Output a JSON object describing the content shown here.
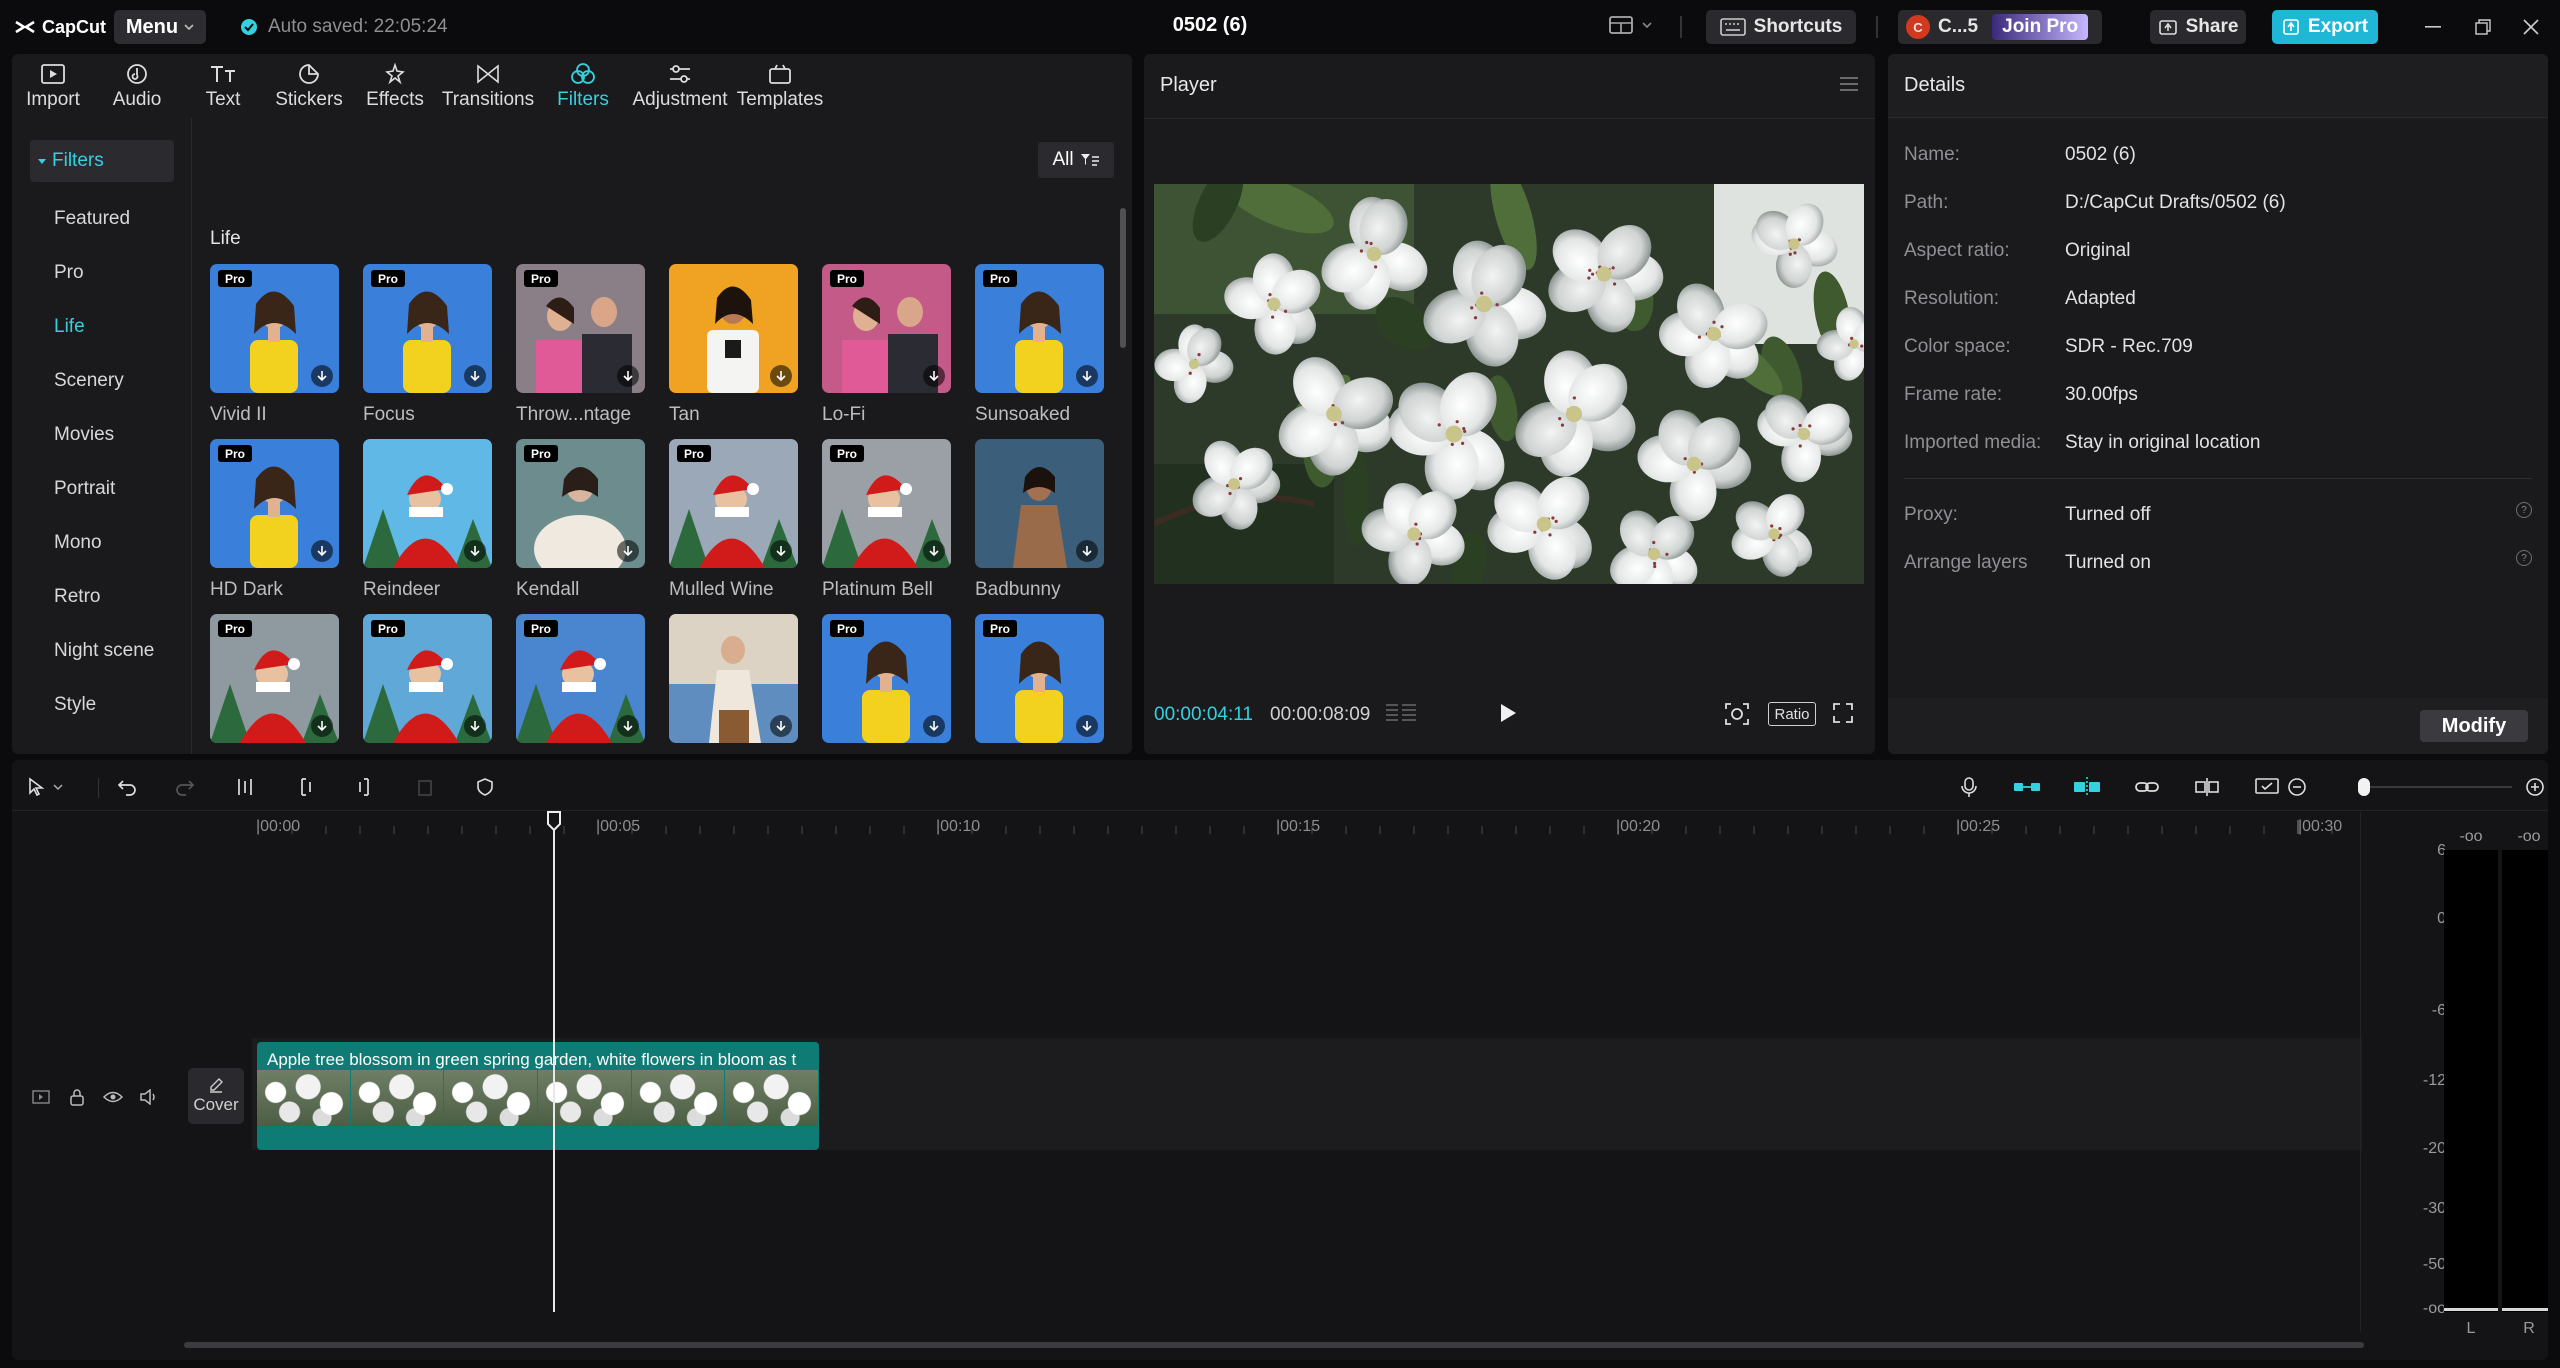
{
  "app": {
    "name": "CapCut",
    "menu_label": "Menu",
    "autosave": "Auto saved: 22:05:24",
    "project_title": "0502 (6)"
  },
  "topbar": {
    "shortcuts_label": "Shortcuts",
    "account_label": "C...5",
    "account_initial": "C",
    "join_pro_label": "Join Pro",
    "share_label": "Share",
    "export_label": "Export"
  },
  "categories": [
    {
      "label": "Import",
      "icon": "import-icon"
    },
    {
      "label": "Audio",
      "icon": "audio-icon"
    },
    {
      "label": "Text",
      "icon": "text-icon"
    },
    {
      "label": "Stickers",
      "icon": "stickers-icon"
    },
    {
      "label": "Effects",
      "icon": "effects-icon"
    },
    {
      "label": "Transitions",
      "icon": "transitions-icon"
    },
    {
      "label": "Filters",
      "icon": "filters-icon",
      "active": true
    },
    {
      "label": "Adjustment",
      "icon": "adjustment-icon"
    },
    {
      "label": "Templates",
      "icon": "templates-icon"
    }
  ],
  "sidebar": {
    "header": "Filters",
    "items": [
      "Featured",
      "Pro",
      "Life",
      "Scenery",
      "Movies",
      "Portrait",
      "Mono",
      "Retro",
      "Night scene",
      "Style"
    ],
    "active": "Life"
  },
  "filter_panel": {
    "all_label": "All",
    "section": "Life",
    "pro_badge": "Pro",
    "row1": [
      "Vivid II",
      "Focus",
      "Throw...ntage",
      "Tan",
      "Lo-Fi",
      "Sunsoaked"
    ],
    "row2": [
      "HD Dark",
      "Reindeer",
      "Kendall",
      "Mulled Wine",
      "Platinum Bell",
      "Badbunny"
    ]
  },
  "player": {
    "title": "Player",
    "current_time": "00:00:04:11",
    "total_time": "00:00:08:09",
    "ratio_label": "Ratio"
  },
  "details": {
    "title": "Details",
    "rows": [
      {
        "label": "Name:",
        "value": "0502 (6)"
      },
      {
        "label": "Path:",
        "value": "D:/CapCut Drafts/0502 (6)"
      },
      {
        "label": "Aspect ratio:",
        "value": "Original"
      },
      {
        "label": "Resolution:",
        "value": "Adapted"
      },
      {
        "label": "Color space:",
        "value": "SDR - Rec.709"
      },
      {
        "label": "Frame rate:",
        "value": "30.00fps"
      },
      {
        "label": "Imported media:",
        "value": "Stay in original location"
      },
      {
        "label": "Proxy:",
        "value": "Turned off"
      },
      {
        "label": "Arrange layers",
        "value": "Turned on"
      }
    ],
    "modify_label": "Modify"
  },
  "timeline": {
    "ruler_labels": [
      "|00:00",
      "|00:05",
      "|00:10",
      "|00:15",
      "|00:20",
      "|00:25",
      "|00:30"
    ],
    "clip_title": "Apple tree blossom in green spring garden, white flowers in bloom as t",
    "cover_label": "Cover",
    "meter_labels": [
      "6",
      "0",
      "-6",
      "-12",
      "-20",
      "-30",
      "-50",
      "-oo"
    ],
    "meter_top": [
      "-oo",
      "-oo"
    ],
    "meter_channels": [
      "L",
      "R"
    ]
  },
  "colors": {
    "accent": "#34d1e0",
    "export": "#1fb7d6",
    "clip": "#0e7b74",
    "pro_badge": "#5b2bd9"
  }
}
